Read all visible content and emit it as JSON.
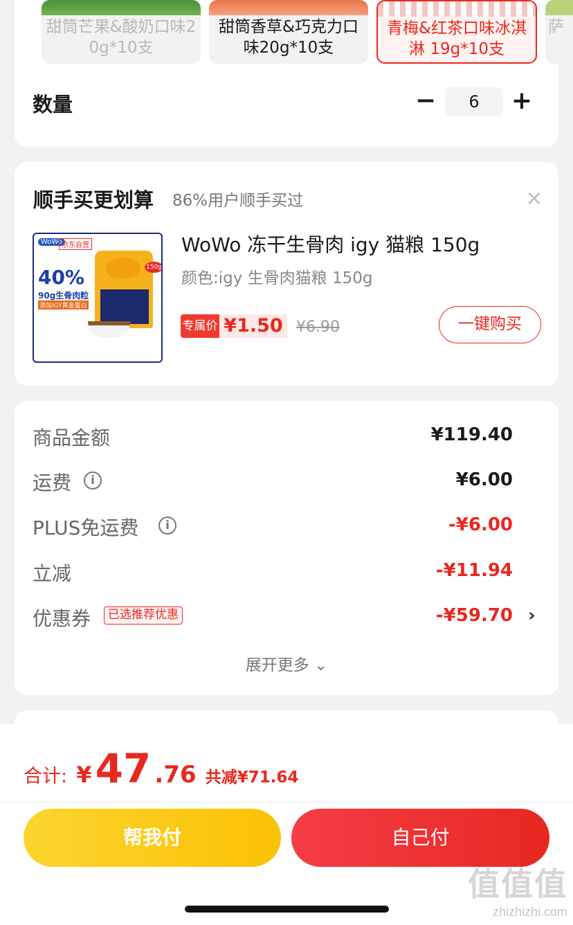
{
  "sku": {
    "variants": [
      {
        "label": "甜筒芒果&酸奶口味20g*10支",
        "state": "disabled"
      },
      {
        "label": "甜筒香草&巧克力口味20g*10支",
        "state": "normal"
      },
      {
        "label": "青梅&红茶口味冰淇淋 19g*10支",
        "state": "selected"
      },
      {
        "label": "萨",
        "state": "normal"
      }
    ],
    "quantity_label": "数量",
    "quantity_value": "6",
    "minus": "−",
    "plus": "+"
  },
  "addon": {
    "title": "顺手买更划算",
    "subtitle": "86%用户顺手买过",
    "close": "×",
    "product": {
      "name": "WoWo 冻干生骨肉 igy 猫粮 150g",
      "spec": "颜色:igy 生骨肉猫粮 150g",
      "price_tag": "专属价",
      "price": "¥1.50",
      "original_price": "¥6.90",
      "buy_button": "一键购买",
      "image_texts": {
        "brand": "WoWo",
        "store": "京东自营",
        "big": "40%",
        "line1": "90g生骨肉粒",
        "line2": "添加IGY黄金蛋白",
        "weight": "150g"
      }
    }
  },
  "summary": {
    "rows": [
      {
        "label": "商品金额",
        "value": "¥119.40"
      },
      {
        "label": "运费",
        "value": "¥6.00"
      },
      {
        "label": "PLUS免运费",
        "value": "-¥6.00"
      },
      {
        "label": "立减",
        "value": "-¥11.94"
      },
      {
        "label": "优惠券",
        "value": "-¥59.70"
      }
    ],
    "info_glyph": "i",
    "coupon_badge": "已选推荐优惠",
    "chevron": "›",
    "expand": "展开更多 ⌄"
  },
  "footer": {
    "total_label": "合计:",
    "currency": "¥",
    "total_integer": "47",
    "total_decimal": ".76",
    "saved": "共减¥71.64",
    "help_pay": "帮我付",
    "self_pay": "自己付"
  },
  "watermark": {
    "big": "值值值",
    "small": "zhizhizhi.com"
  },
  "colors": {
    "accent_red": "#e8281f",
    "yellow": "#fbc104"
  }
}
